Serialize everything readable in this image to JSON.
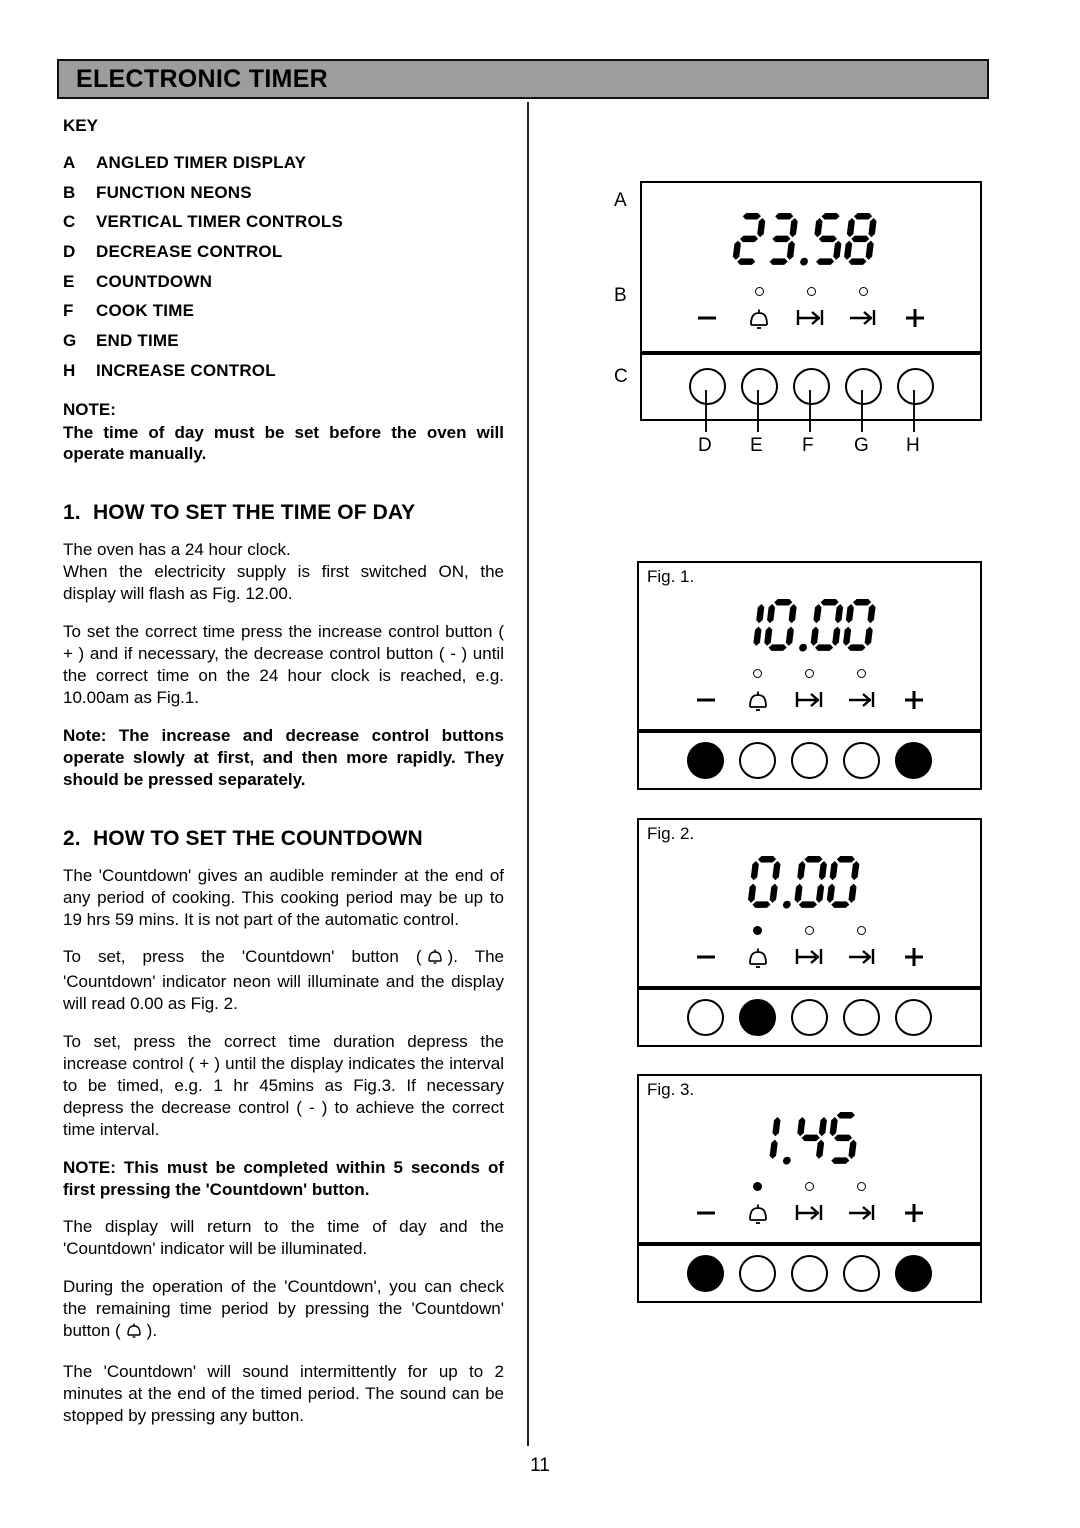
{
  "header": {
    "title": "ELECTRONIC TIMER",
    "bar_color": "#9d9d9d"
  },
  "key": {
    "heading": "KEY",
    "items": [
      {
        "letter": "A",
        "label": "ANGLED TIMER DISPLAY"
      },
      {
        "letter": "B",
        "label": "FUNCTION NEONS"
      },
      {
        "letter": "C",
        "label": "VERTICAL TIMER CONTROLS"
      },
      {
        "letter": "D",
        "label": "DECREASE CONTROL"
      },
      {
        "letter": "E",
        "label": "COUNTDOWN"
      },
      {
        "letter": "F",
        "label": "COOK TIME"
      },
      {
        "letter": "G",
        "label": "END TIME"
      },
      {
        "letter": "H",
        "label": "INCREASE CONTROL"
      }
    ]
  },
  "note": {
    "heading": "NOTE:",
    "body": "The time of day must be set before the oven will operate manually."
  },
  "section1": {
    "number": "1.",
    "title": "HOW TO SET THE TIME OF DAY",
    "p1": "The oven has a 24 hour clock.",
    "p2": "When the electricity supply is first switched ON, the display will flash as Fig. 12.00.",
    "p3": "To set the correct time press the increase control button ( + ) and if necessary, the decrease control button ( - ) until the correct time on the 24 hour clock is reached, e.g. 10.00am as Fig.1.",
    "note": "Note: The increase and decrease control buttons operate slowly at first, and then more rapidly. They should be pressed separately."
  },
  "section2": {
    "number": "2.",
    "title": "HOW TO SET THE COUNTDOWN",
    "p1": "The 'Countdown' gives an audible reminder at the end of any period of cooking.  This cooking period may be up to 19 hrs 59 mins.  It is not part of the automatic control.",
    "p2_a": "To set, press the 'Countdown' button (",
    "p2_b": ").  The 'Countdown' indicator neon will illuminate and the display will read 0.00 as Fig. 2.",
    "p3": "To set, press the correct time duration depress the increase control ( + ) until the display indicates the interval to be timed, e.g. 1 hr 45mins as Fig.3. If necessary depress the decrease control ( - ) to achieve the correct time interval.",
    "note": "NOTE:  This must be completed within 5 seconds of first pressing the 'Countdown' button.",
    "p4": "The display will return to the time of day and the 'Countdown' indicator will be illuminated.",
    "p5_a": "During the operation of the 'Countdown', you can check the remaining time period by pressing the 'Countdown' button (",
    "p5_b": ").",
    "p6": "The 'Countdown' will sound intermittently for up to 2 minutes at the end of the timed period.  The sound can be stopped by pressing any button."
  },
  "diagram_main": {
    "display_value": "23.58",
    "callouts": {
      "a": "A",
      "b": "B",
      "c": "C",
      "d": "D",
      "e": "E",
      "f": "F",
      "g": "G",
      "h": "H"
    },
    "neons": [
      "blank",
      "off",
      "off",
      "off",
      "blank"
    ],
    "icons": [
      "minus-icon",
      "bell-icon",
      "cook-time-icon",
      "end-time-icon",
      "plus-icon"
    ],
    "buttons": [
      "off",
      "off",
      "off",
      "off",
      "off"
    ]
  },
  "figures": [
    {
      "label": "Fig. 1.",
      "display_value": "10.00",
      "neons": [
        "blank",
        "off",
        "off",
        "off",
        "blank"
      ],
      "buttons": [
        "on",
        "off",
        "off",
        "off",
        "on"
      ]
    },
    {
      "label": "Fig. 2.",
      "display_value": "0.00",
      "neons": [
        "blank",
        "on",
        "off",
        "off",
        "blank"
      ],
      "buttons": [
        "off",
        "on",
        "off",
        "off",
        "off"
      ]
    },
    {
      "label": "Fig. 3.",
      "display_value": "1.45",
      "neons": [
        "blank",
        "on",
        "off",
        "off",
        "blank"
      ],
      "buttons": [
        "on",
        "off",
        "off",
        "off",
        "on"
      ]
    }
  ],
  "page_number": "11"
}
